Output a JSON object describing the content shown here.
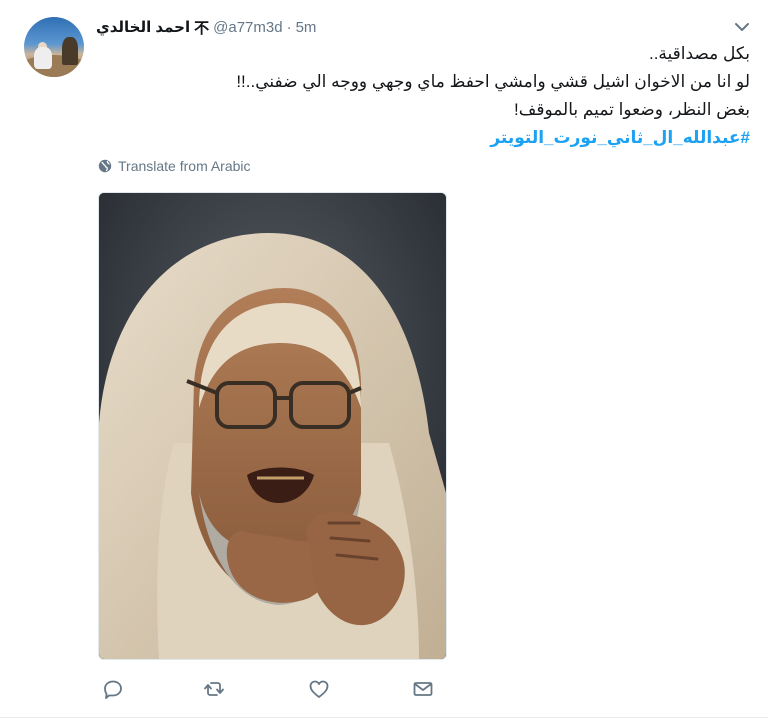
{
  "tweet": {
    "author_name": "احمد الخالدي",
    "name_mark": "不",
    "handle": "@a77m3d",
    "separator": "·",
    "time": "5m",
    "lines": [
      "بكل مصداقية..",
      "لو انا من الاخوان اشيل قشي وامشي احفظ ماي وجهي ووجه الي ضفني..!!",
      "بغض النظر، وضعوا تميم بالموقف!"
    ],
    "hashtag": "#عبدالله_ال_ثاني_نورت_التويتر",
    "translate_label": "Translate from Arabic"
  },
  "colors": {
    "link": "#1da1f2",
    "muted": "#657786",
    "text": "#14171a",
    "border": "#e6ecf0"
  },
  "icons": {
    "menu": "chevron-down-icon",
    "translate": "globe-icon",
    "reply": "reply-icon",
    "retweet": "retweet-icon",
    "like": "heart-icon",
    "message": "envelope-icon"
  }
}
